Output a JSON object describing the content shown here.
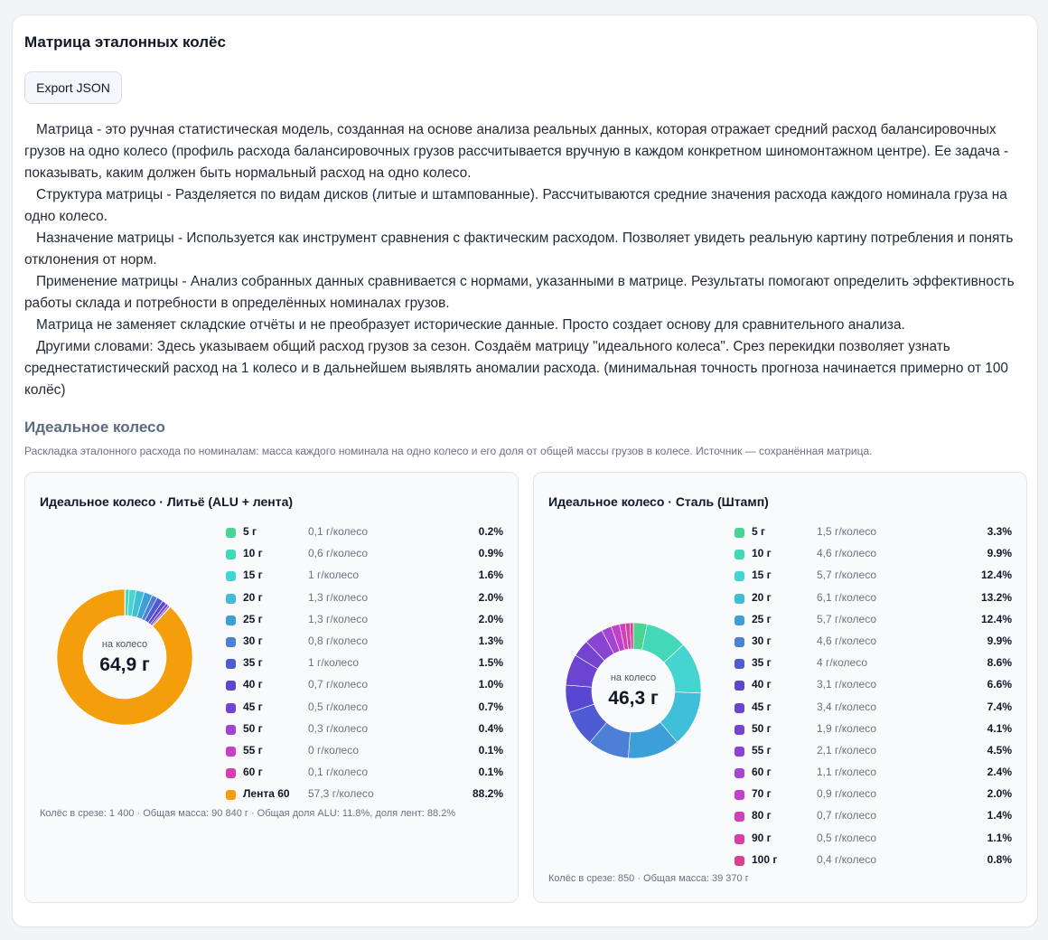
{
  "header": {
    "title": "Матрица эталонных колёс",
    "export_label": "Export JSON"
  },
  "description": [
    "Матрица - это ручная статистическая модель, созданная на основе анализа реальных данных, которая отражает средний расход балансировочных грузов на одно колесо (профиль расхода балансировочных грузов рассчитывается вручную в каждом конкретном шиномонтажном центре). Ее задача - показывать, каким должен быть нормальный расход на одно колесо.",
    "Структура матрицы - Разделяется по видам дисков (литые и штампованные). Рассчитываются средние значения расхода каждого номинала груза на одно колесо.",
    "Назначение матрицы - Используется как инструмент сравнения с фактическим расходом. Позволяет увидеть реальную картину потребления и понять отклонения от норм.",
    "Применение матрицы - Анализ собранных данных сравнивается с нормами, указанными в матрице. Результаты помогают определить эффективность работы склада и потребности в определённых номиналах грузов.",
    "Матрица не заменяет складские отчёты и не преобразует исторические данные. Просто создает основу для сравнительного анализа.",
    "Другими словами: Здесь указываем общий расход грузов за сезон. Создаём матрицу \"идеального колеса\". Срез перекидки позволяет узнать среднестатистический расход на 1 колесо и в дальнейшем выявлять аномалии расхода. (минимальная точность прогноза начинается примерно от 100 колёс)"
  ],
  "ideal": {
    "title": "Идеальное колесо",
    "caption": "Раскладка эталонного расхода по номиналам: масса каждого номинала на одно колесо и его доля от общей массы грузов в колесе. Источник — сохранённая матрица."
  },
  "chart_data": [
    {
      "type": "pie",
      "title": "Идеальное колесо · Литьё (ALU + лента)",
      "center_label": "на колесо",
      "center_value": "64,9 г",
      "footer": "Колёс в срезе: 1 400 · Общая масса: 90 840 г · Общая доля ALU: 11.8%, доля лент: 88.2%",
      "slices": [
        {
          "name": "5 г",
          "mass": "0,1 г/колесо",
          "pct": "0.2%",
          "value": 0.2,
          "color": "#4ad391"
        },
        {
          "name": "10 г",
          "mass": "0,6 г/колесо",
          "pct": "0.9%",
          "value": 0.9,
          "color": "#43d8b8"
        },
        {
          "name": "15 г",
          "mass": "1 г/колесо",
          "pct": "1.6%",
          "value": 1.6,
          "color": "#45d4cf"
        },
        {
          "name": "20 г",
          "mass": "1,3 г/колесо",
          "pct": "2.0%",
          "value": 2.0,
          "color": "#3fbfd7"
        },
        {
          "name": "25 г",
          "mass": "1,3 г/колесо",
          "pct": "2.0%",
          "value": 2.0,
          "color": "#3d9fd8"
        },
        {
          "name": "30 г",
          "mass": "0,8 г/колесо",
          "pct": "1.3%",
          "value": 1.3,
          "color": "#4c7fd6"
        },
        {
          "name": "35 г",
          "mass": "1 г/колесо",
          "pct": "1.5%",
          "value": 1.5,
          "color": "#4e5bd4"
        },
        {
          "name": "40 г",
          "mass": "0,7 г/колесо",
          "pct": "1.0%",
          "value": 1.0,
          "color": "#5847d1"
        },
        {
          "name": "45 г",
          "mass": "0,5 г/колесо",
          "pct": "0.7%",
          "value": 0.7,
          "color": "#7443cf"
        },
        {
          "name": "50 г",
          "mass": "0,3 г/колесо",
          "pct": "0.4%",
          "value": 0.4,
          "color": "#9c45d3"
        },
        {
          "name": "55 г",
          "mass": "0 г/колесо",
          "pct": "0.1%",
          "value": 0.1,
          "color": "#c241c9"
        },
        {
          "name": "60 г",
          "mass": "0,1 г/колесо",
          "pct": "0.1%",
          "value": 0.1,
          "color": "#d63fb2"
        },
        {
          "name": "Лента 60",
          "mass": "57,3 г/колесо",
          "pct": "88.2%",
          "value": 88.2,
          "color": "#f59e0b"
        }
      ]
    },
    {
      "type": "pie",
      "title": "Идеальное колесо · Сталь (Штамп)",
      "center_label": "на колесо",
      "center_value": "46,3 г",
      "footer": "Колёс в срезе: 850 · Общая масса: 39 370 г",
      "slices": [
        {
          "name": "5 г",
          "mass": "1,5 г/колесо",
          "pct": "3.3%",
          "value": 3.3,
          "color": "#4ad391"
        },
        {
          "name": "10 г",
          "mass": "4,6 г/колесо",
          "pct": "9.9%",
          "value": 9.9,
          "color": "#43d8b8"
        },
        {
          "name": "15 г",
          "mass": "5,7 г/колесо",
          "pct": "12.4%",
          "value": 12.4,
          "color": "#45d4cf"
        },
        {
          "name": "20 г",
          "mass": "6,1 г/колесо",
          "pct": "13.2%",
          "value": 13.2,
          "color": "#3fbfd7"
        },
        {
          "name": "25 г",
          "mass": "5,7 г/колесо",
          "pct": "12.4%",
          "value": 12.4,
          "color": "#3d9fd8"
        },
        {
          "name": "30 г",
          "mass": "4,6 г/колесо",
          "pct": "9.9%",
          "value": 9.9,
          "color": "#4c7fd6"
        },
        {
          "name": "35 г",
          "mass": "4 г/колесо",
          "pct": "8.6%",
          "value": 8.6,
          "color": "#4e5bd4"
        },
        {
          "name": "40 г",
          "mass": "3,1 г/колесо",
          "pct": "6.6%",
          "value": 6.6,
          "color": "#5847d1"
        },
        {
          "name": "45 г",
          "mass": "3,4 г/колесо",
          "pct": "7.4%",
          "value": 7.4,
          "color": "#6a45d2"
        },
        {
          "name": "50 г",
          "mass": "1,9 г/колесо",
          "pct": "4.1%",
          "value": 4.1,
          "color": "#7443cf"
        },
        {
          "name": "55 г",
          "mass": "2,1 г/колесо",
          "pct": "4.5%",
          "value": 4.5,
          "color": "#8a44d2"
        },
        {
          "name": "60 г",
          "mass": "1,1 г/колесо",
          "pct": "2.4%",
          "value": 2.4,
          "color": "#a545d3"
        },
        {
          "name": "70 г",
          "mass": "0,9 г/колесо",
          "pct": "2.0%",
          "value": 2.0,
          "color": "#c241c9"
        },
        {
          "name": "80 г",
          "mass": "0,7 г/колесо",
          "pct": "1.4%",
          "value": 1.4,
          "color": "#d040b9"
        },
        {
          "name": "90 г",
          "mass": "0,5 г/колесо",
          "pct": "1.1%",
          "value": 1.1,
          "color": "#d63fa6"
        },
        {
          "name": "100 г",
          "mass": "0,4 г/колесо",
          "pct": "0.8%",
          "value": 0.8,
          "color": "#dc3f8e"
        }
      ]
    }
  ]
}
